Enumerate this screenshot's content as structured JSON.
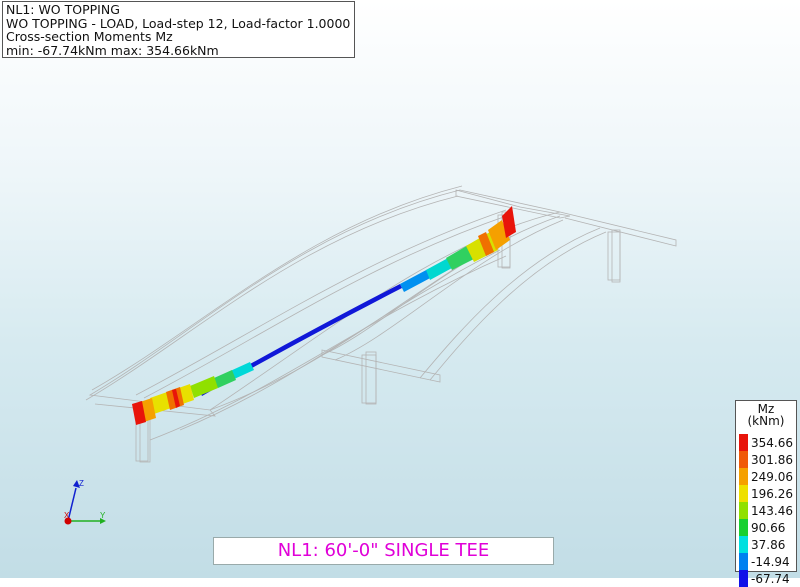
{
  "info": {
    "line1": "NL1: WO TOPPING",
    "line2": "WO TOPPING - LOAD, Load-step 12, Load-factor 1.0000",
    "line3": "Cross-section Moments Mz",
    "line4": "min: -67.74kNm max: 354.66kNm"
  },
  "legend": {
    "title_line1": "Mz",
    "title_line2": "(kNm)",
    "items": [
      {
        "value": "354.66",
        "color": "#e8140a"
      },
      {
        "value": "301.86",
        "color": "#f05a08"
      },
      {
        "value": "249.06",
        "color": "#f5a000"
      },
      {
        "value": "196.26",
        "color": "#eee000"
      },
      {
        "value": "143.46",
        "color": "#90e000"
      },
      {
        "value": "90.66",
        "color": "#18d030"
      },
      {
        "value": "37.86",
        "color": "#00e0e0"
      },
      {
        "value": "-14.94",
        "color": "#0080f0"
      },
      {
        "value": "-67.74",
        "color": "#1010e8"
      }
    ]
  },
  "axes": {
    "x_label": "X",
    "y_label": "Y",
    "z_label": "Z",
    "x_color": "#d00000",
    "y_color": "#20b020",
    "z_color": "#1020d0"
  },
  "caption": "NL1: 60'-0\" SINGLE TEE"
}
